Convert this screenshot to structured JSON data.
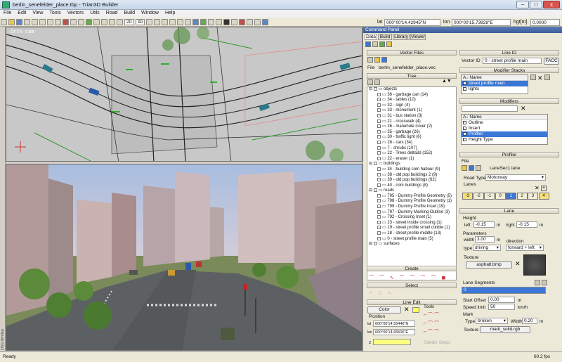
{
  "window": {
    "title": "berlin_senefelder_place.tbp - Trian3D Builder",
    "min": "–",
    "max": "□",
    "close": "x"
  },
  "menu": [
    "File",
    "Edit",
    "View",
    "Tools",
    "Vectors",
    "Utils",
    "Road",
    "Build",
    "Window",
    "Help"
  ],
  "toolbar": {
    "view_2d": "2D",
    "view_3d": "3D"
  },
  "coords": {
    "lat_label": "lat",
    "lat_value": "000°00'14.42945\"N",
    "lon_label": "lon",
    "lon_value": "000°00'15.73928\"E",
    "hgt_label": "hgt[m]",
    "hgt_value": "0.0000"
  },
  "topview": {
    "label": "Orth cam"
  },
  "panel": {
    "title": "Command Panel",
    "tabs": [
      "Data",
      "Build",
      "Library",
      "Viewer"
    ],
    "vector_files": {
      "header": "Vector Files",
      "file_label": "File",
      "file_value": "berlin_senefelder_place.vec"
    },
    "tree": {
      "header": "Tree",
      "groups": [
        {
          "name": "objects",
          "items": [
            "36 - garbage can (14)",
            "34 - tables (10)",
            "32 - sign (4)",
            "33 - monument (1)",
            "31 - bus station (3)",
            "21 - crosswalk (4)",
            "26 - manehole cover (2)",
            "35 - garbage (26)",
            "30 - traffic light (6)",
            "28 - cars (34)",
            "7 - shrubs (107)",
            "22 - Trees delta3d (152)",
            "22 - eraser (1)"
          ]
        },
        {
          "name": "buildings",
          "items": [
            "34 - building com habour (9)",
            "38 - old pop buildings 2 (9)",
            "39 - old pop buildings (62)",
            "40 - com buildings (8)"
          ]
        },
        {
          "name": "roads",
          "items": [
            "795 - Dummy Profile Geometry (5)",
            "798 - Dummy Profile Geometry (1)",
            "799 - Dummy Profile Inset (19)",
            "797 - Dummy Marking Outline (3)",
            "792 - Crossing Inset (1)",
            "23 - street inside crossing (1)",
            "19 - street profile small cobble (1)",
            "18 - street profile middle (13)",
            "0 - street profile main (5)"
          ]
        },
        {
          "name": "surfaces",
          "items": []
        }
      ]
    },
    "create": {
      "header": "Create"
    },
    "select": {
      "header": "Select"
    },
    "line_edit": {
      "header": "Line Edit",
      "color_button": "Color",
      "tools_label": "Tools",
      "position_label": "Position",
      "lat_label": "lat",
      "lat_value": "000°00'14.55446\"N",
      "lon_label": "lon",
      "lon_value": "000°00'14.65506\"E",
      "z_label": "z",
      "z_value": "",
      "subdiv_label": "Subdiv Steps"
    },
    "line_id": {
      "header": "Line ID",
      "label": "Vector ID",
      "value": "0 - street profile main",
      "facc_button": "FACC"
    },
    "modifier_stacks": {
      "header": "Modifier Stacks",
      "col_name": "Name",
      "rows": [
        {
          "name": "street profile main",
          "selected": true
        },
        {
          "name": "lights",
          "selected": false
        }
      ]
    },
    "modifiers": {
      "header": "Modifiers",
      "col_name": "Name",
      "rows": [
        {
          "name": "Outline",
          "selected": false
        },
        {
          "name": "Insert",
          "selected": false
        },
        {
          "name": "Profiler",
          "selected": true
        },
        {
          "name": "Height Type",
          "selected": false
        }
      ]
    },
    "profiler": {
      "header": "Profiler",
      "file_label": "File",
      "file_value": "LaneSec1.lane",
      "road_type_label": "Road Type",
      "road_type_value": "Motorway",
      "lanes_label": "Lanes",
      "lanes": [
        {
          "id": "-3",
          "color": "#f5e07a"
        },
        {
          "id": "-2",
          "color": "#f1eed8"
        },
        {
          "id": "-1",
          "color": "#f1eed8"
        },
        {
          "id": "0",
          "color": "#f1eed8"
        },
        {
          "id": "1",
          "color": "#3a77d6"
        },
        {
          "id": "2",
          "color": "#f1eed8"
        },
        {
          "id": "3",
          "color": "#f1eed8"
        },
        {
          "id": "4",
          "color": "#f5e07a"
        }
      ]
    },
    "lane": {
      "header": "Lane",
      "height_label": "Height",
      "left_label": "left",
      "left_value": "-0.15",
      "right_label": "right",
      "right_value": "-0.15",
      "unit_m": "m",
      "params_label": "Parameters",
      "width_label": "width",
      "width_value": "3.00",
      "direction_label": "direction",
      "type_label": "type",
      "type_value": "driving",
      "direction_value": "forward + left",
      "texture_label": "Texture",
      "texture_button": "asphalt.bmp"
    },
    "lane_segments": {
      "label": "Lane Segments",
      "rows": [
        "0"
      ],
      "start_offset_label": "Start Offset",
      "start_offset_value": "0.00",
      "speed_label": "Speed limit",
      "speed_value": "50",
      "speed_unit": "km/h",
      "mark_label": "Mark",
      "mark_type_label": "Type",
      "mark_type_value": "broken",
      "mark_width_label": "Width",
      "mark_width_value": "0.20",
      "mark_texture_label": "Texture",
      "mark_texture_value": "mark_solid.rgb"
    }
  },
  "status": {
    "left": "Ready",
    "right": "60.2 fps"
  },
  "side": {
    "label": "OSG Window"
  }
}
